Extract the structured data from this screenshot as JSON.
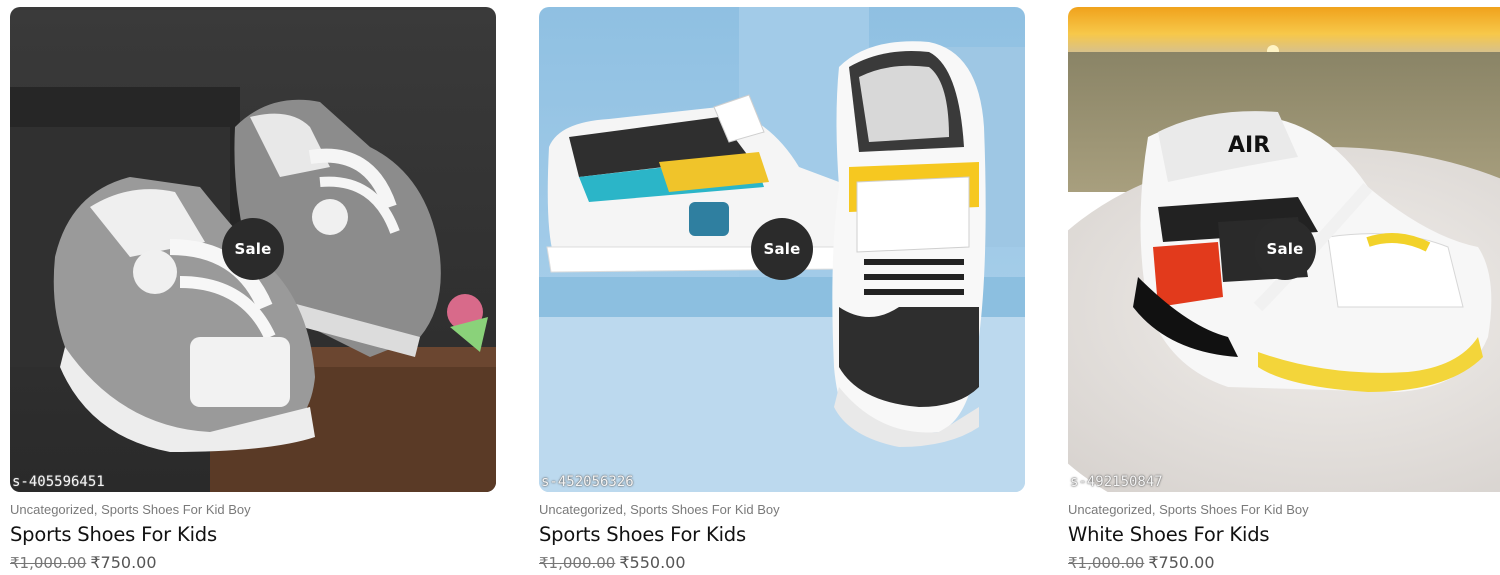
{
  "products": [
    {
      "badge": "Sale",
      "sku": "s-405596451",
      "categories": [
        "Uncategorized",
        "Sports Shoes For Kid Boy"
      ],
      "title": "Sports Shoes For Kids",
      "regular_price": "₹1,000.00",
      "sale_price": "₹750.00",
      "image_icon": "grey-sneakers-image"
    },
    {
      "badge": "Sale",
      "sku": "s-452056326",
      "categories": [
        "Uncategorized",
        "Sports Shoes For Kid Boy"
      ],
      "title": "Sports Shoes For Kids",
      "regular_price": "₹1,000.00",
      "sale_price": "₹550.00",
      "image_icon": "white-yellow-sneakers-image"
    },
    {
      "badge": "Sale",
      "sku": "s-492150847",
      "categories": [
        "Uncategorized",
        "Sports Shoes For Kid Boy"
      ],
      "title": "White Shoes For Kids",
      "regular_price": "₹1,000.00",
      "sale_price": "₹750.00",
      "image_icon": "white-air-sneaker-image"
    }
  ],
  "separator": ", ",
  "colors": {
    "badge_bg": "#2b2b2b",
    "text": "#111111",
    "muted": "#7a7a7a"
  }
}
